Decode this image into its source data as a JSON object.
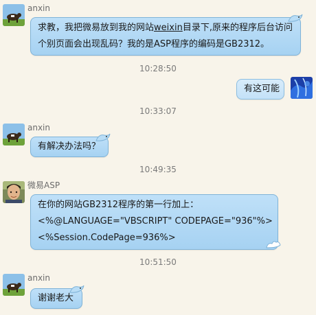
{
  "messages": [
    {
      "sender": "anxin",
      "lines": [
        "求教，我把微易放到我的网站",
        "weixin",
        "目录下,原来的程序后台访问",
        "个别页面会出现乱码？我的是ASP程序的编码是GB2312。"
      ],
      "time": "10:28:50"
    },
    {
      "sender": "",
      "text": "有这可能",
      "time": "10:33:07"
    },
    {
      "sender": "anxin",
      "text": "有解决办法吗？",
      "time": "10:49:35"
    },
    {
      "sender": "微易ASP",
      "lines": [
        "在你的网站GB2312程序的第一行加上：",
        "<%@LANGUAGE=\"VBSCRIPT\" CODEPAGE=\"936\"%>",
        "<%Session.CodePage=936%>"
      ],
      "time": "10:51:50"
    },
    {
      "sender": "anxin",
      "text": "谢谢老大"
    }
  ],
  "colors": {
    "background": "#f8f4ea",
    "bubble": "#a6d2f2",
    "bubble_border": "#7fb3d8",
    "timestamp": "#7a7a7a",
    "name": "#6b6b6b"
  },
  "icons": {
    "anxin_avatar": "cow-avatar",
    "me_avatar": "abstract-blue-avatar",
    "weiyi_avatar": "person-photo-avatar",
    "bubble_decoration": "bird-icon"
  }
}
